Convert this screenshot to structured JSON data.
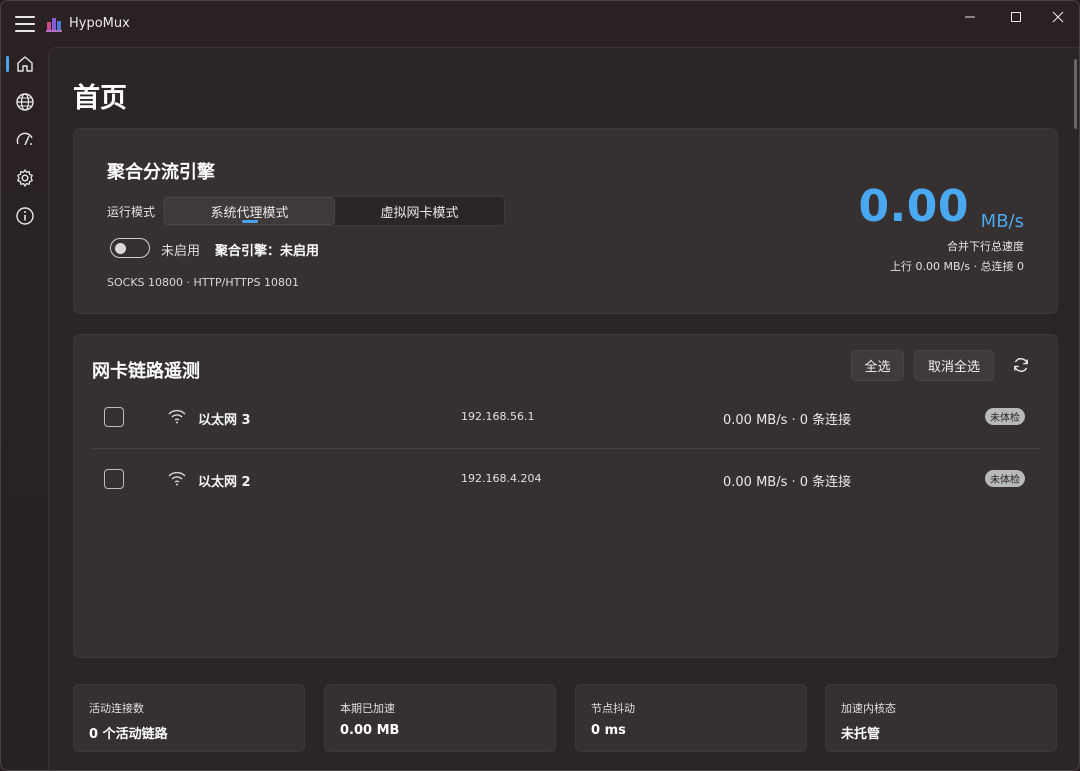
{
  "window": {
    "app_title": "HypoMux",
    "controls": {
      "minimize": "minimize-icon",
      "maximize": "maximize-icon",
      "close": "close-icon"
    }
  },
  "sidebar": {
    "items": [
      {
        "name": "home",
        "icon": "home-icon",
        "active": true
      },
      {
        "name": "globe",
        "icon": "globe-icon",
        "active": false
      },
      {
        "name": "speed",
        "icon": "speedometer-icon",
        "active": false
      },
      {
        "name": "settings",
        "icon": "gear-icon",
        "active": false
      },
      {
        "name": "info",
        "icon": "info-icon",
        "active": false
      }
    ]
  },
  "page": {
    "title": "首页"
  },
  "engine": {
    "title": "聚合分流引擎",
    "mode_label": "运行模式",
    "modes": [
      "系统代理模式",
      "虚拟网卡模式"
    ],
    "active_mode": "系统代理模式",
    "toggle_label": "未启用",
    "status": "聚合引擎：未启用",
    "ports": "SOCKS 10800 · HTTP/HTTPS 10801",
    "speed_value": "0.00",
    "speed_unit": "MB/s",
    "speed_caption": "合并下行总速度",
    "speed_sub": "上行 0.00 MB/s · 总连接 0"
  },
  "telemetry": {
    "title": "网卡链路遥测",
    "select_all": "全选",
    "deselect_all": "取消全选",
    "adapters": [
      {
        "name": "以太网 3",
        "ip": "192.168.56.1",
        "stats": "0.00 MB/s · 0 条连接",
        "badge": "未体检"
      },
      {
        "name": "以太网 2",
        "ip": "192.168.4.204",
        "stats": "0.00 MB/s · 0 条连接",
        "badge": "未体检"
      }
    ]
  },
  "stats": [
    {
      "label": "活动连接数",
      "value": "0 个活动链路"
    },
    {
      "label": "本期已加速",
      "value": "0.00 MB"
    },
    {
      "label": "节点抖动",
      "value": "0 ms"
    },
    {
      "label": "加速内核态",
      "value": "未托管"
    }
  ],
  "colors": {
    "accent": "#4aa8f0",
    "background": "#2a2222",
    "card": "#363030",
    "badge": "#b9b9b9"
  }
}
